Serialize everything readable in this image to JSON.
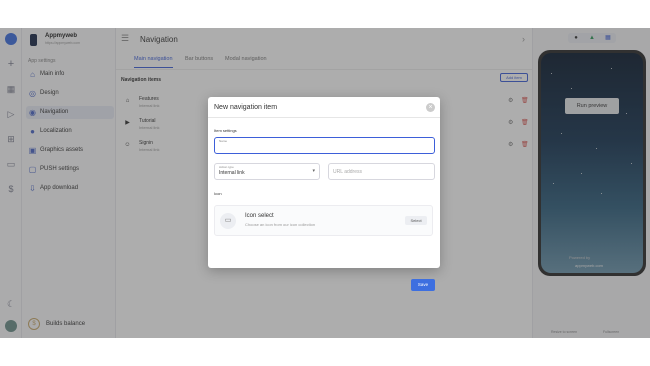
{
  "project": {
    "name": "Appmyweb",
    "url": "https://appmyweb.com"
  },
  "sidebar": {
    "section": "App settings",
    "items": [
      {
        "label": "Main info",
        "icon": "home-icon"
      },
      {
        "label": "Design",
        "icon": "palette-icon"
      },
      {
        "label": "Navigation",
        "icon": "navigation-icon"
      },
      {
        "label": "Localization",
        "icon": "globe-icon"
      },
      {
        "label": "Graphics assets",
        "icon": "image-icon"
      },
      {
        "label": "PUSH settings",
        "icon": "bell-icon"
      },
      {
        "label": "App download",
        "icon": "download-icon"
      }
    ],
    "builds": "Builds balance"
  },
  "header": {
    "title": "Navigation"
  },
  "tabs": [
    {
      "label": "Main navigation"
    },
    {
      "label": "Bar buttons"
    },
    {
      "label": "Modal navigation"
    }
  ],
  "nav_items": {
    "heading": "Navigation items",
    "add_label": "Add item",
    "rows": [
      {
        "title": "Features",
        "sub": "Internal link"
      },
      {
        "title": "Tutorial",
        "sub": "Internal link"
      },
      {
        "title": "Signin",
        "sub": "Internal link"
      }
    ]
  },
  "preview": {
    "run_label": "Run preview",
    "powered": "Powered by",
    "brand": "appmyweb.com",
    "footer_left": "Resize to screen",
    "footer_right": "Fullscreen"
  },
  "modal": {
    "title": "New navigation item",
    "item_settings": "Item settings",
    "name_label": "Name",
    "action_label": "Action type",
    "action_value": "Internal link",
    "url_placeholder": "URL address",
    "icon_label": "Icon",
    "icon_select_title": "Icon select",
    "icon_select_sub": "Choose an icon from our icon collection",
    "select_label": "Select",
    "save_label": "Save"
  },
  "colors": {
    "accent": "#3d6fe0",
    "delete": "#d9534f"
  }
}
